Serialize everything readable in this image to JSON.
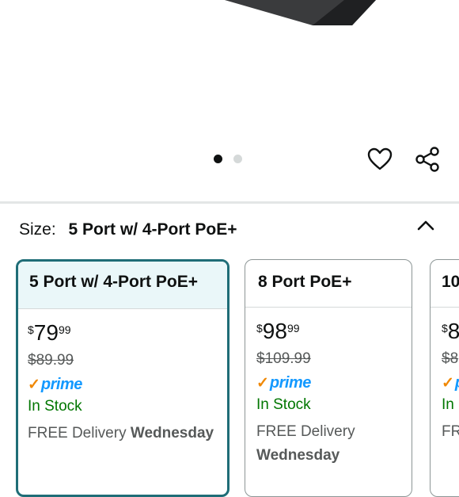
{
  "carousel": {
    "image_count": 2,
    "active_index": 0
  },
  "actions": {
    "wishlist_icon": "heart-icon",
    "share_icon": "share-icon"
  },
  "size": {
    "label": "Size:",
    "selected": "5 Port w/ 4-Port PoE+",
    "collapse_icon": "chevron-up-icon"
  },
  "options": [
    {
      "title": "5 Port w/ 4-Port PoE+",
      "price_symbol": "$",
      "price_whole": "79",
      "price_fraction": "99",
      "list_price": "$89.99",
      "prime": "prime",
      "stock": "In Stock",
      "delivery_prefix": "FREE Delivery",
      "delivery_day": "Wednesday",
      "selected": true
    },
    {
      "title": "8 Port PoE+",
      "price_symbol": "$",
      "price_whole": "98",
      "price_fraction": "99",
      "list_price": "$109.99",
      "prime": "prime",
      "stock": "In Stock",
      "delivery_prefix": "FREE Delivery",
      "delivery_day": "Wednesday",
      "selected": false
    },
    {
      "title": "10",
      "price_symbol": "$",
      "price_whole": "8",
      "price_fraction": "",
      "list_price": "$8",
      "prime": "p",
      "stock": "In",
      "delivery_prefix": "FR",
      "delivery_day": "",
      "selected": false
    }
  ],
  "colors": {
    "accent": "#1f6d77",
    "selected_bg": "#eaf7f9",
    "in_stock": "#007600",
    "prime_blue": "#1399ff",
    "prime_check": "#f08804"
  }
}
